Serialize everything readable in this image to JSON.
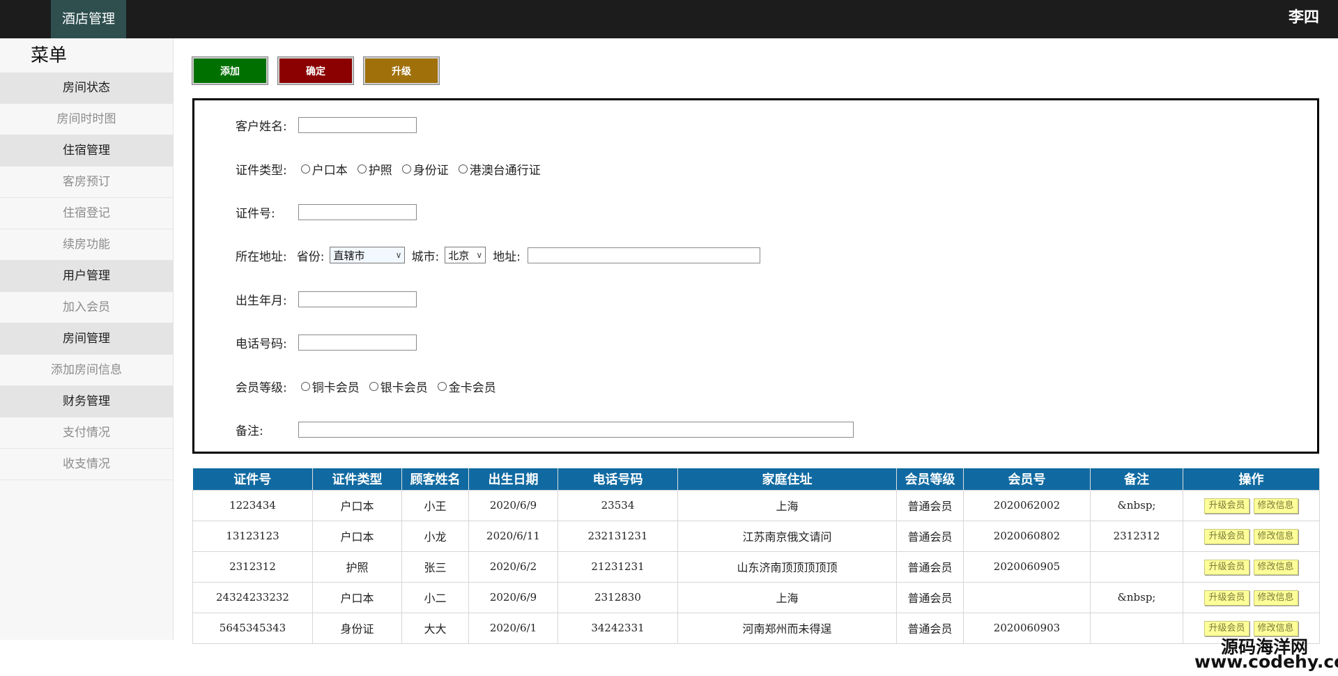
{
  "header": {
    "brand": "酒店管理",
    "user": "李四"
  },
  "sidebar": {
    "title": "菜单",
    "items": [
      {
        "label": "房间状态",
        "type": "group"
      },
      {
        "label": "房间时时图",
        "type": "sub"
      },
      {
        "label": "住宿管理",
        "type": "group"
      },
      {
        "label": "客房预订",
        "type": "sub"
      },
      {
        "label": "住宿登记",
        "type": "sub"
      },
      {
        "label": "续房功能",
        "type": "sub"
      },
      {
        "label": "用户管理",
        "type": "group"
      },
      {
        "label": "加入会员",
        "type": "sub"
      },
      {
        "label": "房间管理",
        "type": "group"
      },
      {
        "label": "添加房间信息",
        "type": "sub"
      },
      {
        "label": "财务管理",
        "type": "group"
      },
      {
        "label": "支付情况",
        "type": "sub"
      },
      {
        "label": "收支情况",
        "type": "sub"
      }
    ]
  },
  "toolbar": {
    "add": "添加",
    "confirm": "确定",
    "upgrade": "升级"
  },
  "form": {
    "name_label": "客户姓名:",
    "idtype_label": "证件类型:",
    "idtype_options": [
      "户口本",
      "护照",
      "身份证",
      "港澳台通行证"
    ],
    "idno_label": "证件号:",
    "address_label": "所在地址:",
    "province_label": "省份:",
    "province_value": "直辖市",
    "city_label": "城市:",
    "city_value": "北京",
    "addr_label": "地址:",
    "birth_label": "出生年月:",
    "phone_label": "电话号码:",
    "level_label": "会员等级:",
    "level_options": [
      "铜卡会员",
      "银卡会员",
      "金卡会员"
    ],
    "note_label": "备注:"
  },
  "table": {
    "headers": [
      "证件号",
      "证件类型",
      "顾客姓名",
      "出生日期",
      "电话号码",
      "家庭住址",
      "会员等级",
      "会员号",
      "备注",
      "操作"
    ],
    "op_upgrade": "升级会员",
    "op_edit": "修改信息",
    "rows": [
      [
        "1223434",
        "户口本",
        "小王",
        "2020/6/9",
        "23534",
        "上海",
        "普通会员",
        "2020062002",
        "&nbsp;"
      ],
      [
        "13123123",
        "户口本",
        "小龙",
        "2020/6/11",
        "232131231",
        "江苏南京俄文请问",
        "普通会员",
        "2020060802",
        "2312312"
      ],
      [
        "2312312",
        "护照",
        "张三",
        "2020/6/2",
        "21231231",
        "山东济南顶顶顶顶顶",
        "普通会员",
        "2020060905",
        ""
      ],
      [
        "24324233232",
        "户口本",
        "小二",
        "2020/6/9",
        "2312830",
        "上海",
        "普通会员",
        "",
        "&nbsp;"
      ],
      [
        "5645345343",
        "身份证",
        "大大",
        "2020/6/1",
        "34242331",
        "河南郑州而未得逞",
        "普通会员",
        "2020060903",
        ""
      ]
    ]
  },
  "watermark": {
    "line1": "源码海洋网",
    "line2": "www.codehy.com"
  }
}
